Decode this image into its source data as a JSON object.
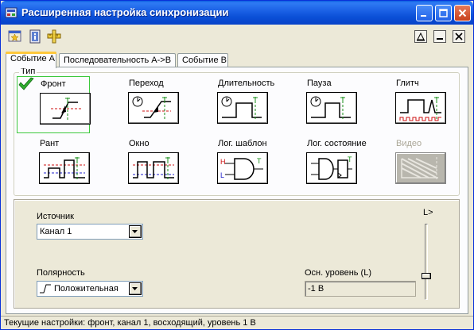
{
  "window": {
    "title": "Расширенная настройка синхронизации"
  },
  "tabs": [
    {
      "label": "Событие A",
      "active": true
    },
    {
      "label": "Последовательность A->B",
      "active": false
    },
    {
      "label": "Событие B",
      "active": false
    }
  ],
  "type_group": {
    "label": "Тип",
    "items": [
      {
        "label": "Фронт",
        "icon": "edge-trigger-icon",
        "selected": true,
        "enabled": true
      },
      {
        "label": "Переход",
        "icon": "transition-trigger-icon",
        "selected": false,
        "enabled": true
      },
      {
        "label": "Длительность",
        "icon": "duration-trigger-icon",
        "selected": false,
        "enabled": true
      },
      {
        "label": "Пауза",
        "icon": "pause-trigger-icon",
        "selected": false,
        "enabled": true
      },
      {
        "label": "Глитч",
        "icon": "glitch-trigger-icon",
        "selected": false,
        "enabled": true
      },
      {
        "label": "Рант",
        "icon": "runt-trigger-icon",
        "selected": false,
        "enabled": true
      },
      {
        "label": "Окно",
        "icon": "window-trigger-icon",
        "selected": false,
        "enabled": true
      },
      {
        "label": "Лог. шаблон",
        "icon": "logic-pattern-icon",
        "selected": false,
        "enabled": true
      },
      {
        "label": "Лог. состояние",
        "icon": "logic-state-icon",
        "selected": false,
        "enabled": true
      },
      {
        "label": "Видео",
        "icon": "video-trigger-icon",
        "selected": false,
        "enabled": false
      }
    ]
  },
  "source": {
    "label": "Источник",
    "value": "Канал 1"
  },
  "polarity": {
    "label": "Полярность",
    "value": "Положительная"
  },
  "level": {
    "label": "Осн. уровень (L)",
    "value": "-1 В",
    "slider_label": "L>",
    "slider_fraction": 0.25
  },
  "status": {
    "text": "Текущие настройки: фронт, канал 1, восходящий, уровень 1 В"
  },
  "colors": {
    "selection": "#3cc83c",
    "title_bar": "#0a4fd6",
    "trace_green": "#1a8f1a",
    "trace_red": "#cc1111",
    "trace_blue": "#2020cc"
  }
}
